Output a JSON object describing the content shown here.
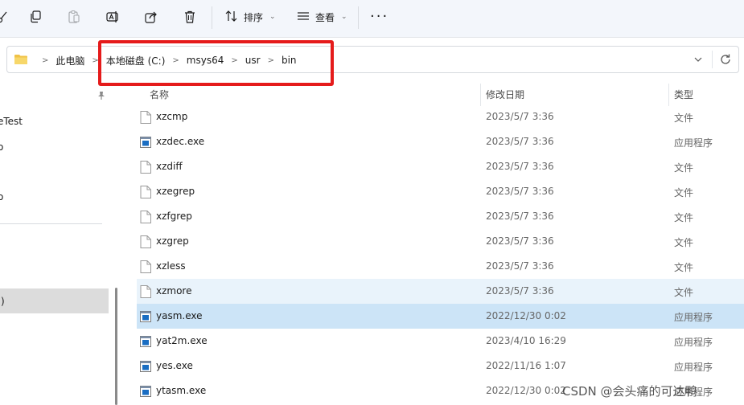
{
  "toolbar": {
    "sort_label": "排序",
    "view_label": "查看",
    "more_label": "···"
  },
  "address": {
    "crumbs": [
      "此电脑",
      "本地磁盘 (C:)",
      "msys64",
      "usr",
      "bin"
    ]
  },
  "nav": {
    "items": [
      "eTest",
      "o",
      "o",
      ":)"
    ]
  },
  "columns": {
    "name": "名称",
    "date": "修改日期",
    "type": "类型"
  },
  "files": [
    {
      "name": "xzcmp",
      "date": "2023/5/7 3:36",
      "type": "文件",
      "kind": "file"
    },
    {
      "name": "xzdec.exe",
      "date": "2023/5/7 3:36",
      "type": "应用程序",
      "kind": "exe"
    },
    {
      "name": "xzdiff",
      "date": "2023/5/7 3:36",
      "type": "文件",
      "kind": "file"
    },
    {
      "name": "xzegrep",
      "date": "2023/5/7 3:36",
      "type": "文件",
      "kind": "file"
    },
    {
      "name": "xzfgrep",
      "date": "2023/5/7 3:36",
      "type": "文件",
      "kind": "file"
    },
    {
      "name": "xzgrep",
      "date": "2023/5/7 3:36",
      "type": "文件",
      "kind": "file"
    },
    {
      "name": "xzless",
      "date": "2023/5/7 3:36",
      "type": "文件",
      "kind": "file"
    },
    {
      "name": "xzmore",
      "date": "2023/5/7 3:36",
      "type": "文件",
      "kind": "file",
      "state": "hover"
    },
    {
      "name": "yasm.exe",
      "date": "2022/12/30 0:02",
      "type": "应用程序",
      "kind": "exe",
      "state": "selected"
    },
    {
      "name": "yat2m.exe",
      "date": "2023/4/10 16:29",
      "type": "应用程序",
      "kind": "exe"
    },
    {
      "name": "yes.exe",
      "date": "2022/11/16 1:07",
      "type": "应用程序",
      "kind": "exe"
    },
    {
      "name": "ytasm.exe",
      "date": "2022/12/30 0:02",
      "type": "应用程序",
      "kind": "exe"
    }
  ],
  "watermark": "CSDN @会头痛的可达鸭",
  "colors": {
    "highlight_box": "#e51b1b",
    "selected_row": "#cce4f7",
    "hover_row": "#e9f3fb",
    "folder": "#f0c246",
    "exe_icon": "#1a6dc2"
  }
}
